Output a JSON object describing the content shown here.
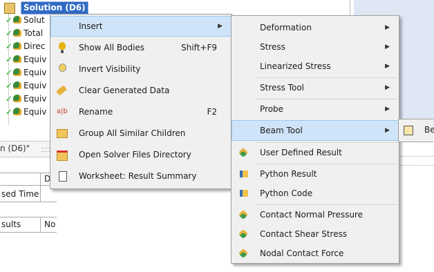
{
  "tree": {
    "root_label": "Solution (D6)",
    "children": [
      "Solut",
      "Total",
      "Direc",
      "Equiv",
      "Equiv",
      "Equiv",
      "Equiv",
      "Equiv"
    ]
  },
  "details": {
    "title": "n (D6)\"",
    "column_header_partial": "D",
    "rows": [
      {
        "label": "sed Time",
        "value": ""
      },
      {
        "label": "sults",
        "value": "No"
      }
    ]
  },
  "context_menu": {
    "items": [
      {
        "label": "Insert",
        "shortcut": "",
        "icon": "insert-icon",
        "submenu": true
      },
      {
        "label": "Show All Bodies",
        "shortcut": "Shift+F9",
        "icon": "bulb-icon"
      },
      {
        "label": "Invert Visibility",
        "shortcut": "",
        "icon": "invert-bulb-icon"
      },
      {
        "label": "Clear Generated Data",
        "shortcut": "",
        "icon": "eraser-icon"
      },
      {
        "label": "Rename",
        "shortcut": "F2",
        "icon": "rename-icon"
      },
      {
        "label": "Group All Similar Children",
        "shortcut": "",
        "icon": "folder-icon"
      },
      {
        "label": "Open Solver Files Directory",
        "shortcut": "",
        "icon": "open-folder-icon"
      },
      {
        "label": "Worksheet: Result Summary",
        "shortcut": "",
        "icon": "worksheet-icon"
      }
    ]
  },
  "insert_submenu": {
    "items": [
      {
        "label": "Deformation",
        "submenu": true
      },
      {
        "label": "Stress",
        "submenu": true
      },
      {
        "label": "Linearized Stress",
        "submenu": true
      },
      {
        "label": "Stress Tool",
        "submenu": true
      },
      {
        "label": "Probe",
        "submenu": true
      },
      {
        "label": "Beam Tool",
        "submenu": true
      },
      {
        "label": "User Defined Result",
        "icon": "user-result-icon"
      },
      {
        "label": "Python Result",
        "icon": "python-icon"
      },
      {
        "label": "Python Code",
        "icon": "python-icon"
      },
      {
        "label": "Contact Normal Pressure",
        "icon": "contact-icon"
      },
      {
        "label": "Contact Shear Stress",
        "icon": "contact-icon"
      },
      {
        "label": "Nodal Contact Force",
        "icon": "contact-icon"
      }
    ]
  },
  "beam_tool_submenu": {
    "items": [
      {
        "label": "Be"
      }
    ]
  }
}
